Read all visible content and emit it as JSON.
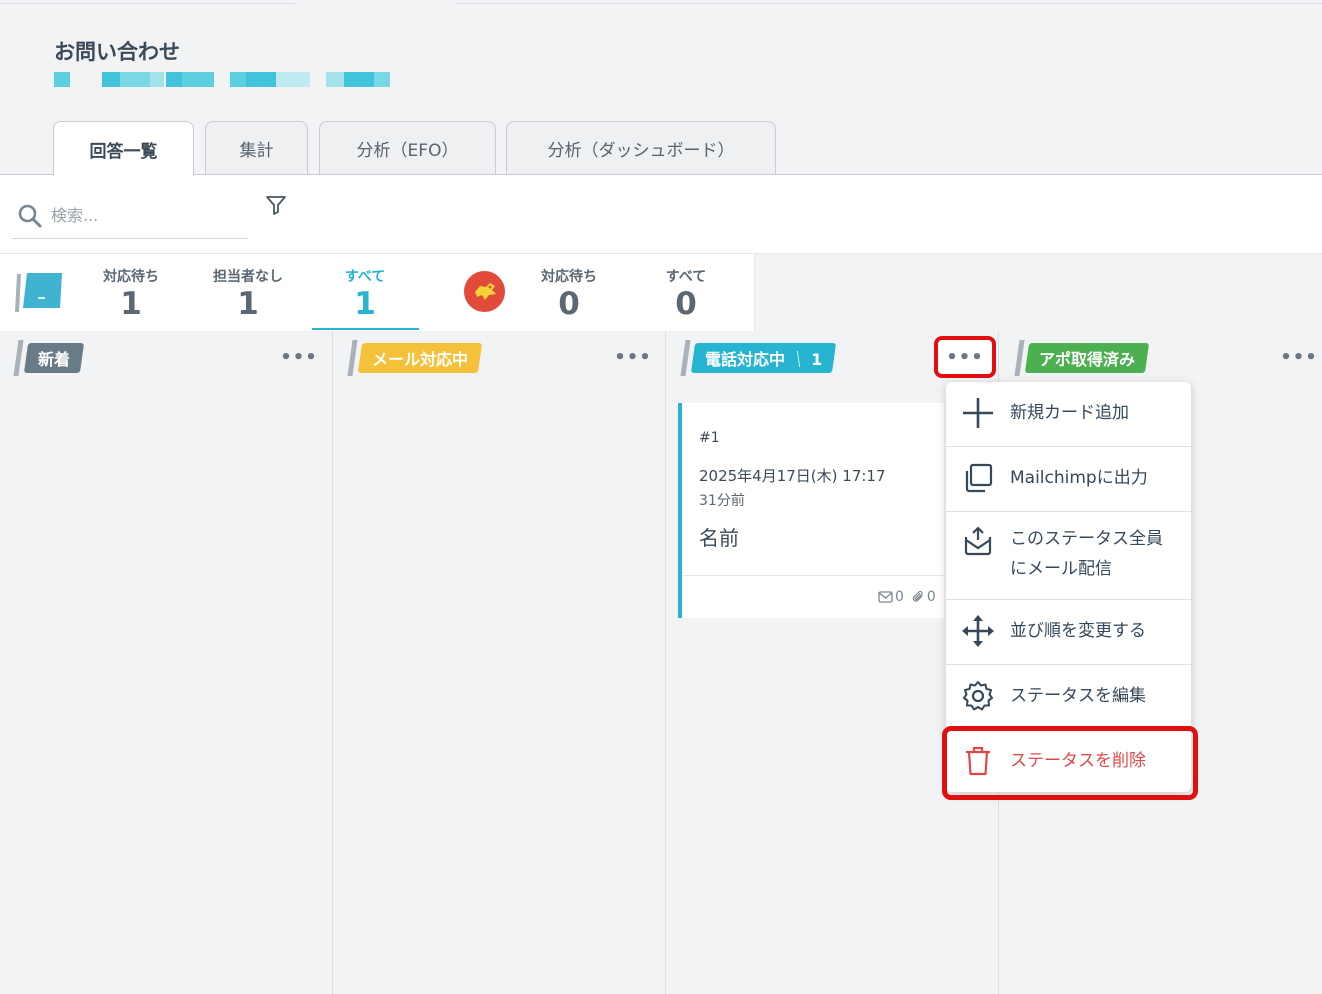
{
  "page": {
    "title": "お問い合わせ"
  },
  "tabs": [
    {
      "label": "回答一覧",
      "active": true
    },
    {
      "label": "集計",
      "active": false
    },
    {
      "label": "分析（EFO）",
      "active": false
    },
    {
      "label": "分析（ダッシュボード）",
      "active": false
    }
  ],
  "search": {
    "placeholder": "検索..."
  },
  "stats": {
    "group1": [
      {
        "label": "対応待ち",
        "value": "1"
      },
      {
        "label": "担当者なし",
        "value": "1"
      },
      {
        "label": "すべて",
        "value": "1",
        "active": true
      }
    ],
    "group2": [
      {
        "label": "対応待ち",
        "value": "0"
      },
      {
        "label": "すべて",
        "value": "0"
      }
    ]
  },
  "columns": [
    {
      "label": "新着",
      "color": "#6a7b88"
    },
    {
      "label": "メール対応中",
      "color": "#f6c13a"
    },
    {
      "label": "電話対応中",
      "count": "1",
      "color": "#27b4d0"
    },
    {
      "label": "アポ取得済み",
      "color": "#4caf50"
    }
  ],
  "card": {
    "number": "#1",
    "datetime": "2025年4月17日(木) 17:17",
    "relative": "31分前",
    "name": "名前",
    "mail_count": "0",
    "attach_count": "0"
  },
  "menu": {
    "items": [
      {
        "label": "新規カード追加",
        "icon": "plus-icon"
      },
      {
        "label": "Mailchimpに出力",
        "icon": "copy-icon"
      },
      {
        "label": "このステータス全員にメール配信",
        "line1": "このステータス全員",
        "line2": "にメール配信",
        "icon": "mail-send-icon"
      },
      {
        "label": "並び順を変更する",
        "icon": "move-icon"
      },
      {
        "label": "ステータスを編集",
        "icon": "gear-icon"
      },
      {
        "label": "ステータスを削除",
        "icon": "trash-icon",
        "danger": true
      }
    ]
  },
  "colors": {
    "accent": "#27b4d0",
    "danger": "#e04848",
    "highlight": "#e01010"
  }
}
